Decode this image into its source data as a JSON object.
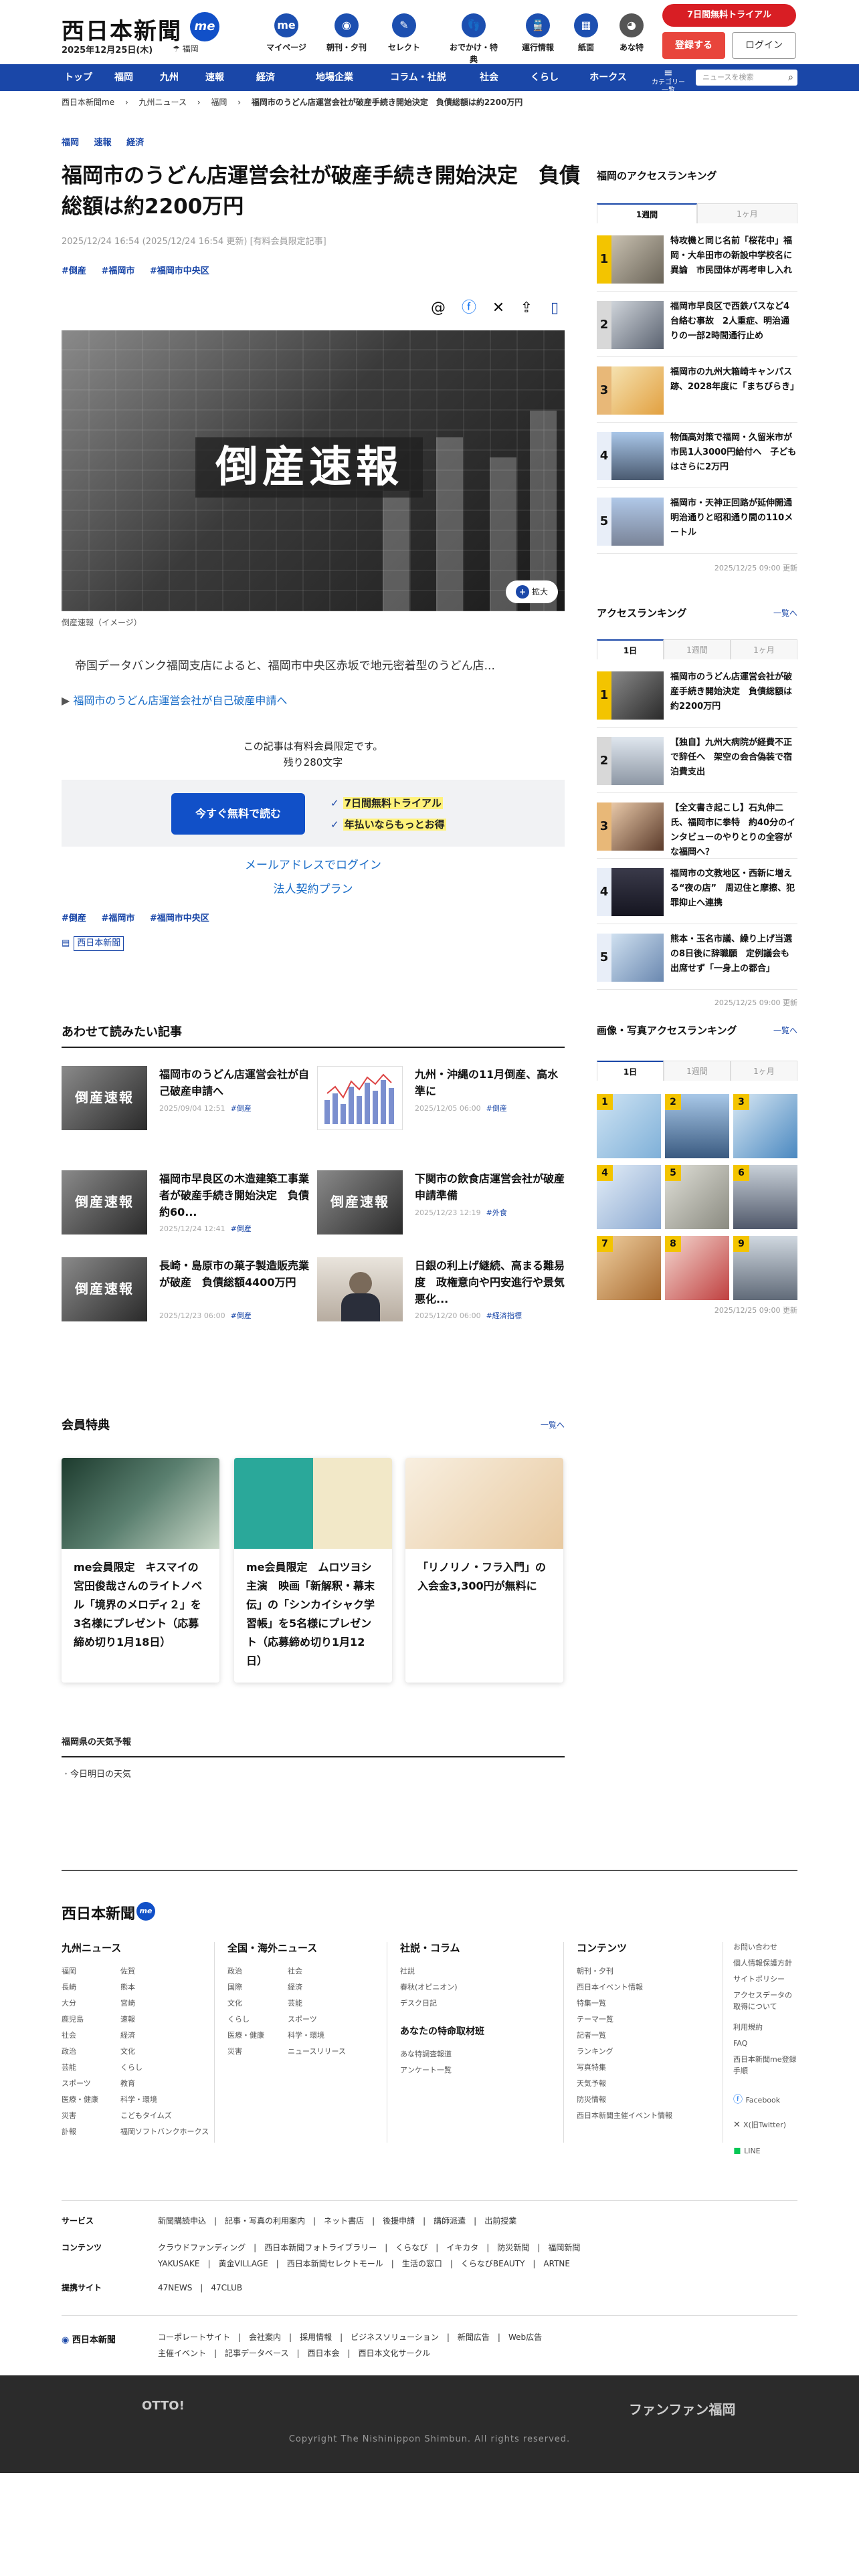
{
  "header": {
    "logo": "西日本新聞",
    "me_badge": "me",
    "date": "2025年12月25日(木)",
    "weather": "☂ 福岡",
    "nav": [
      {
        "label": "マイページ",
        "icon": "me-icon"
      },
      {
        "label": "朝刊・夕刊",
        "icon": "newspaper-icon"
      },
      {
        "label": "セレクト",
        "icon": "select-icon"
      },
      {
        "label": "おでかけ・特典",
        "icon": "footprint-icon"
      },
      {
        "label": "運行情報",
        "icon": "train-icon"
      },
      {
        "label": "紙面",
        "icon": "paper-icon"
      },
      {
        "label": "あな特",
        "icon": "tanuki-icon"
      }
    ],
    "trial": "7日間無料トライアル",
    "register": "登録する",
    "login": "ログイン"
  },
  "gnav": {
    "items": [
      "トップ",
      "福岡",
      "九州",
      "速報",
      "経済",
      "地場企業",
      "コラム・社説",
      "社会",
      "くらし",
      "ホークス"
    ],
    "category_menu": "カテゴリー一覧",
    "search_placeholder": "ニュースを検索"
  },
  "breadcrumb": [
    "西日本新聞me",
    "九州ニュース",
    "福岡",
    "福岡市のうどん店運営会社が破産手続き開始決定　負債総額は約2200万円"
  ],
  "article": {
    "top_tags": [
      "福岡",
      "速報",
      "経済"
    ],
    "title": "福岡市のうどん店運営会社が破産手続き開始決定　負債総額は約2200万円",
    "meta": "2025/12/24 16:54 (2025/12/24 16:54 更新) [有料会員限定記事]",
    "tags": [
      "#倒産",
      "#福岡市",
      "#福岡市中央区"
    ],
    "hero_text": "倒産速報",
    "zoom": "拡大",
    "caption": "倒産速報（イメージ）",
    "lead": "帝国データバンク福岡支店によると、福岡市中央区赤坂で地元密着型のうどん店...",
    "related_link": "福岡市のうどん店運営会社が自己破産申請へ",
    "paywall_note": "この記事は有料会員限定です。",
    "remaining": "残り280文字",
    "free_button": "今すぐ無料で読む",
    "perk1": "7日間無料トライアル",
    "perk2": "年払いならもっとお得",
    "mail_login": "メールアドレスでログイン",
    "corp_plan": "法人契約プラン",
    "newspaper_label": "西日本新聞"
  },
  "recommended": {
    "heading": "あわせて読みたい記事",
    "cards": [
      {
        "title": "福岡市のうどん店運営会社が自己破産申請へ",
        "date": "2025/09/04 12:51",
        "tag": "#倒産",
        "thumb": "倒産速報"
      },
      {
        "title": "九州・沖縄の11月倒産、高水準に",
        "date": "2025/12/05 06:00",
        "tag": "#倒産",
        "thumb": "chart"
      },
      {
        "title": "福岡市早良区の木造建築工事業者が破産手続き開始決定　負債約60...",
        "date": "2025/12/24 12:41",
        "tag": "#倒産",
        "thumb": "倒産速報"
      },
      {
        "title": "下関市の飲食店運営会社が破産申請準備",
        "date": "2025/12/23 12:19",
        "tag": "#外食",
        "thumb": "倒産速報"
      },
      {
        "title": "長崎・島原市の菓子製造販売業が破産　負債総額4400万円",
        "date": "2025/12/23 06:00",
        "tag": "#倒産",
        "thumb": "倒産速報"
      },
      {
        "title": "日銀の利上げ継続、高まる難易度　政権意向や円安進行や景気悪化...",
        "date": "2025/12/20 06:00",
        "tag": "#経済指標",
        "thumb": "photo"
      }
    ]
  },
  "member_perks": {
    "heading": "会員特典",
    "more": "一覧へ",
    "cards": [
      "me会員限定　キスマイの宮田俊哉さんのライトノベル「境界のメロディ２」を3名様にプレゼント（応募締め切り1月18日）",
      "me会員限定　ムロツヨシ主演　映画「新解釈・幕末伝」の「シンカイシャク学習帳」を5名様にプレゼント（応募締め切り1月12日）",
      "「リノリノ・フラ入門」の入会金3,300円が無料に"
    ]
  },
  "weather": {
    "heading": "福岡県の天気予報",
    "item": "今日明日の天気"
  },
  "sidebar": {
    "local_ranking": {
      "heading": "福岡のアクセスランキング",
      "tabs": [
        "1週間",
        "1ヶ月"
      ],
      "items": [
        "特攻機と同じ名前「桜花中」福岡・大牟田市の新設中学校名に異論　市民団体が再考申し入れ",
        "福岡市早良区で西鉄バスなど4台絡む事故　2人重症、明治通りの一部2時間通行止め",
        "福岡市の九州大箱崎キャンパス跡、2028年度に「まちびらき」",
        "物価高対策で福岡・久留米市が市民1人3000円給付へ　子どもはさらに2万円",
        "福岡市・天神正回路が延伸開通　明治通りと昭和通り間の110メートル"
      ],
      "updated": "2025/12/25 09:00 更新"
    },
    "access_ranking": {
      "heading": "アクセスランキング",
      "more": "一覧へ",
      "tabs": [
        "1日",
        "1週間",
        "1ヶ月"
      ],
      "items": [
        "福岡市のうどん店運営会社が破産手続き開始決定　負債総額は約2200万円",
        "【独自】九州大病院が経費不正で辞任へ　架空の会合偽装で宿泊費支出",
        "【全文書き起こし】石丸伸二氏、福岡市に拳特　約40分のインタビューのやりとりの全容がな福岡へ？",
        "福岡市の文教地区・西新に増える“夜の店”　周辺住と摩擦、犯罪抑止へ連携",
        "熊本・玉名市議、繰り上げ当選の8日後に辞職願　定例議会も出席せず「一身上の都合」"
      ],
      "updated": "2025/12/25 09:00 更新"
    },
    "photo_ranking": {
      "heading": "画像・写真アクセスランキング",
      "more": "一覧へ",
      "tabs": [
        "1日",
        "1週間",
        "1ヶ月"
      ],
      "numbers": [
        "1",
        "2",
        "3",
        "4",
        "5",
        "6",
        "7",
        "8",
        "9"
      ],
      "updated": "2025/12/25 09:00 更新"
    }
  },
  "footer": {
    "logo": "西日本新聞",
    "me": "me",
    "columns": [
      {
        "heading": "九州ニュース",
        "links": [
          "福岡",
          "佐賀",
          "長崎",
          "熊本",
          "大分",
          "宮崎",
          "鹿児島",
          "速報",
          "社会",
          "経済",
          "政治",
          "文化",
          "芸能",
          "くらし",
          "スポーツ",
          "教育",
          "医療・健康",
          "科学・環境",
          "災害",
          "こどもタイムズ",
          "訃報",
          "福岡ソフトバンクホークス"
        ]
      },
      {
        "heading": "全国・海外ニュース",
        "links": [
          "政治",
          "社会",
          "国際",
          "経済",
          "文化",
          "芸能",
          "くらし",
          "スポーツ",
          "医療・健康",
          "科学・環境",
          "災害",
          "ニュースリリース"
        ]
      },
      {
        "heading": "社説・コラム",
        "links": [
          "社説",
          "春秋(オピニオン)",
          "デスク日記"
        ],
        "sub_heading": "あなたの特命取材班",
        "sub_links": [
          "あな特調査報道",
          "アンケート一覧"
        ]
      },
      {
        "heading": "コンテンツ",
        "links": [
          "朝刊・夕刊",
          "西日本イベント情報",
          "特集一覧",
          "テーマ一覧",
          "記者一覧",
          "ランキング",
          "写真特集",
          "天気予報",
          "防災情報",
          "西日本新聞主催イベント情報"
        ]
      }
    ],
    "misc_links": [
      "お問い合わせ",
      "個人情報保護方針",
      "サイトポリシー",
      "アクセスデータの取得について",
      "利用規約",
      "FAQ",
      "西日本新聞me登録手順"
    ],
    "social": [
      "Facebook",
      "X(旧Twitter)",
      "LINE"
    ],
    "rows": [
      {
        "label": "サービス",
        "value": "新聞購読申込　|　記事・写真の利用案内　|　ネット書店　|　後援申請　|　講師派遣　|　出前授業"
      },
      {
        "label": "コンテンツ",
        "value": "クラウドファンディング　|　西日本新聞フォトライブラリー　|　くらなび　|　イキカタ　|　防災新聞　|　福岡新聞"
      },
      {
        "label": "",
        "value": "YAKUSAKE　|　黄金VILLAGE　|　西日本新聞セレクトモール　|　生活の窓口　|　くらなびBEAUTY　|　ARTNE"
      },
      {
        "label": "提携サイト",
        "value": "47NEWS　|　47CLUB"
      }
    ],
    "corp_logo": "西日本新聞",
    "corp_links": "コーポレートサイト　|　会社案内　|　採用情報　|　ビジネスソリューション　|　新聞広告　|　Web広告",
    "corp_links2": "主催イベント　|　記事データベース　|　西日本会　|　西日本文化サークル",
    "otto": "OTTO!",
    "fanfun": "ファンファン福岡",
    "copyright": "Copyright The Nishinippon Shimbun. All rights reserved."
  }
}
